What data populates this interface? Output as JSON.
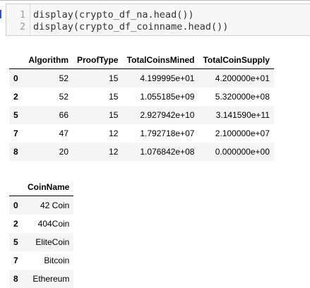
{
  "code_cell": {
    "lines": [
      {
        "number": "1",
        "text": "display(crypto_df_na.head())"
      },
      {
        "number": "2",
        "text": "display(crypto_df_coinname.head())"
      }
    ]
  },
  "table1": {
    "columns": [
      "",
      "Algorithm",
      "ProofType",
      "TotalCoinsMined",
      "TotalCoinSupply"
    ],
    "rows": [
      [
        "0",
        "52",
        "15",
        "4.199995e+01",
        "4.200000e+01"
      ],
      [
        "2",
        "52",
        "15",
        "1.055185e+09",
        "5.320000e+08"
      ],
      [
        "5",
        "66",
        "15",
        "2.927942e+10",
        "3.141590e+11"
      ],
      [
        "7",
        "47",
        "12",
        "1.792718e+07",
        "2.100000e+07"
      ],
      [
        "8",
        "20",
        "12",
        "1.076842e+08",
        "0.000000e+00"
      ]
    ]
  },
  "table2": {
    "columns": [
      "",
      "CoinName"
    ],
    "rows": [
      [
        "0",
        "42 Coin"
      ],
      [
        "2",
        "404Coin"
      ],
      [
        "5",
        "EliteCoin"
      ],
      [
        "7",
        "Bitcoin"
      ],
      [
        "8",
        "Ethereum"
      ]
    ]
  }
}
